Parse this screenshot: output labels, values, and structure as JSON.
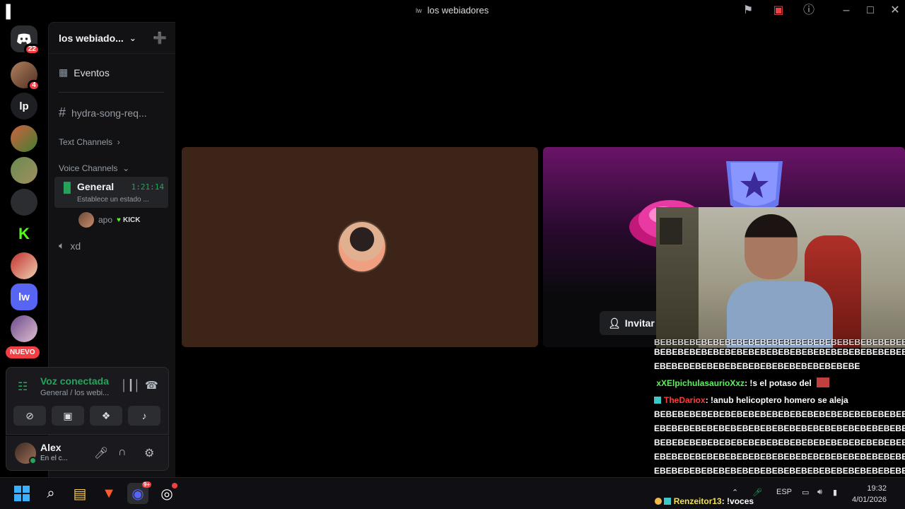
{
  "window": {
    "title": "los webiadores",
    "title_icon_text": "lw"
  },
  "titlebar_icons": [
    "flag-icon",
    "screen-record-icon",
    "help-icon",
    "minimize-icon",
    "maximize-icon",
    "close-icon"
  ],
  "rail": {
    "home_badge": "22",
    "server2_badge": "4",
    "server_lp_label": "lp",
    "server_lw_label": "lw",
    "nuevo_label": "NUEVO"
  },
  "guild": {
    "name": "los webiado...",
    "events_label": "Eventos",
    "text_channel": "hydra-song-req...",
    "category_text": "Text Channels",
    "category_voice": "Voice Channels",
    "active_voice": {
      "name": "General",
      "timer": "1:21:14",
      "status": "Establece un estado ..."
    },
    "voice_user": {
      "name": "apo",
      "tag": "KICK"
    },
    "other_voice": "xd"
  },
  "voice_panel": {
    "title": "Voz conectada",
    "subtitle": "General / los webi..."
  },
  "user_panel": {
    "name": "Alex",
    "status": "En el c..."
  },
  "stage": {
    "invite_label": "Invitar"
  },
  "chat": {
    "top_partial": "BEBEBEBEBEBEBEBEBEBEBEBEBEBEBEBEBEBEBEBEBEBEBEBEBEBE",
    "line1a": "BEBEBEBEBEBEBEBEBEBEBEBEBEBEBEBEBEBEBEBEBEBEBEBEBEBE",
    "line1b": "EBEBEBEBEBEBEBEBEBEBEBEBEBEBEBEBEBE",
    "msg2_user": "xXElpichulasaurioXxz",
    "msg2_text": ": !s el potaso del",
    "msg3_user": "TheDariox",
    "msg3_text": ": !anub helicoptero homero se aleja",
    "spam": [
      "BEBEBEBEBEBEBEBEBEBEBEBEBEBEBEBEBEBEBEBEBEBEBEBEBEBE",
      "EBEBEBEBEBEBEBEBEBEBEBEBEBEBEBEBEBEBEBEBEBEBEBEBEBEBE",
      "BEBEBEBEBEBEBEBEBEBEBEBEBEBEBEBEBEBEBEBEBEBEBEBEBEBE",
      "EBEBEBEBEBEBEBEBEBEBEBEBEBEBEBEBEBEBEBEBEBEBEBEBEBEBE",
      "EBEBEBEBEBEBEBEBEBEBEBEBEBEBEBEBEBEBEBEBEBEBEBEBEBEBE"
    ],
    "msg4_user": "Renzeitor13",
    "msg4_text": ": !voces"
  },
  "taskbar": {
    "lang": "ESP",
    "time": "19:32",
    "date": "4/01/2026",
    "discord_badge": "9+"
  },
  "colors": {
    "green": "#23a55a",
    "red": "#f23f43",
    "blurple": "#5865f2"
  }
}
